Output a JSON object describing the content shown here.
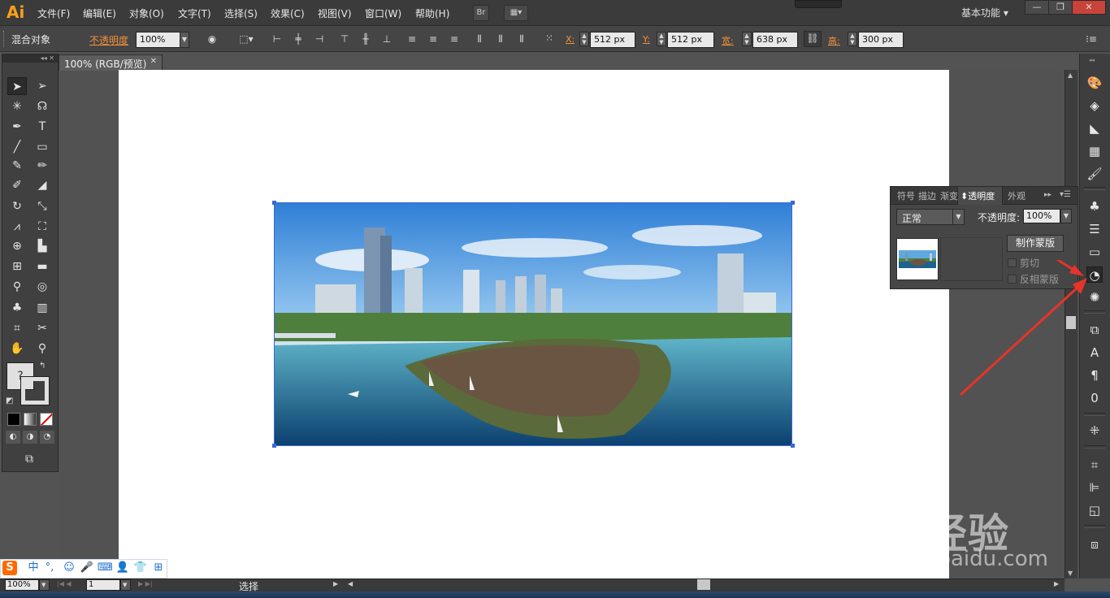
{
  "app": {
    "logo": "Ai",
    "menu": [
      "文件(F)",
      "编辑(E)",
      "对象(O)",
      "文字(T)",
      "选择(S)",
      "效果(C)",
      "视图(V)",
      "窗口(W)",
      "帮助(H)"
    ],
    "bridge_label": "Br",
    "workspace": "基本功能",
    "window_controls": [
      "—",
      "❐",
      "✕"
    ]
  },
  "control_bar": {
    "object_type": "混合对象",
    "opacity_label": "不透明度",
    "opacity_value": "100%",
    "x_label": "X:",
    "x_value": "512 px",
    "y_label": "Y:",
    "y_value": "512 px",
    "w_label": "宽:",
    "w_value": "638 px",
    "h_label": "高:",
    "h_value": "300 px"
  },
  "document": {
    "tab_title": "100% (RGB/预览)",
    "tab_close": "✕"
  },
  "transparency_panel": {
    "tabs": [
      "符号",
      "描边",
      "渐变",
      "透明度",
      "外观"
    ],
    "active_tab": "透明度",
    "blend_mode": "正常",
    "opacity_label": "不透明度:",
    "opacity_value": "100%",
    "make_mask_button": "制作蒙版",
    "clip_label": "剪切",
    "invert_mask_label": "反相蒙版"
  },
  "status_bar": {
    "zoom": "100%",
    "artboard": "1",
    "tool_status": "选择"
  },
  "ime_bar": {
    "logo": "S",
    "lang": "中",
    "punct": "°,"
  },
  "watermark": {
    "logo": "Bai经验",
    "url": "jingyan.baidu.com"
  }
}
